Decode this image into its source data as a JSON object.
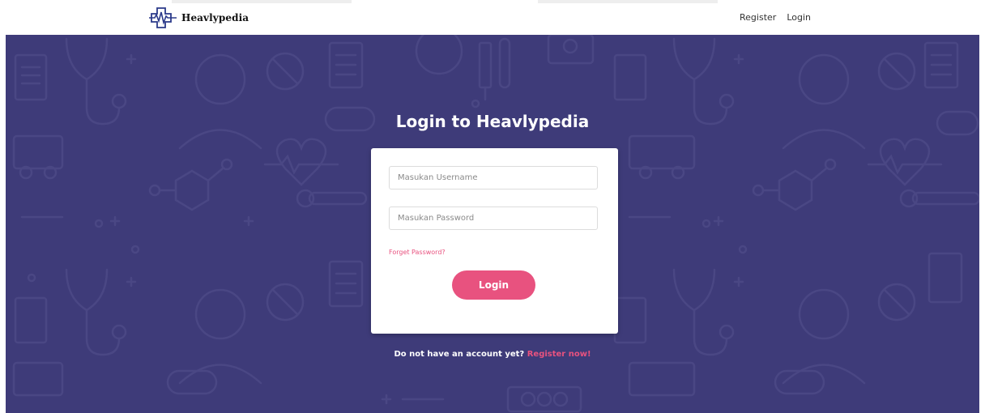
{
  "navbar": {
    "brand_name": "Heavlypedia",
    "links": {
      "register": "Register",
      "login": "Login"
    }
  },
  "login": {
    "title": "Login to Heavlypedia",
    "username_placeholder": "Masukan Username",
    "password_placeholder": "Masukan Password",
    "forgot_password": "Forget Password?",
    "submit_label": "Login",
    "signup_prompt": "Do not have an account yet?",
    "signup_link": "Register now!"
  },
  "colors": {
    "background": "#3e3b79",
    "accent": "#e8527f",
    "pattern": "#4a4784"
  },
  "icons": {
    "logo": "medical-cross-heartbeat-icon",
    "pattern": [
      "stethoscope-icon",
      "pill-icon",
      "clipboard-icon",
      "heart-pulse-icon",
      "thermometer-icon",
      "molecule-icon",
      "doctor-icon",
      "nurse-icon",
      "syringe-icon",
      "ambulance-icon"
    ]
  }
}
